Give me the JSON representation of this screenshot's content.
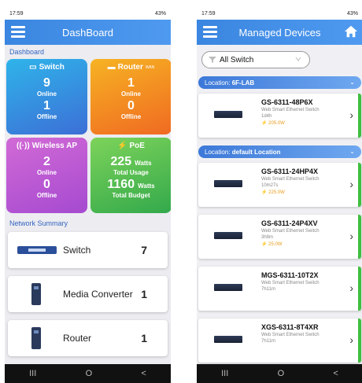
{
  "left": {
    "status": {
      "time": "17:59",
      "battery": "43%"
    },
    "appbar_title": "DashBoard",
    "section_label": "Dashboard",
    "tiles": {
      "switch": {
        "title": "Switch",
        "online": "9",
        "online_label": "Online",
        "offline": "1",
        "offline_label": "Offline"
      },
      "router": {
        "title": "Router",
        "title_suffix": "WAN",
        "online": "1",
        "online_label": "Online",
        "offline": "0",
        "offline_label": "Offline"
      },
      "wap": {
        "title": "Wireless AP",
        "online": "2",
        "online_label": "Online",
        "offline": "0",
        "offline_label": "Offline"
      },
      "poe": {
        "title": "PoE",
        "usage": "225",
        "usage_units": "Watts",
        "usage_label": "Total Usage",
        "budget": "1160",
        "budget_units": "Watts",
        "budget_label": "Total Budget"
      }
    },
    "summary_label": "Network Summary",
    "summary": [
      {
        "name": "Switch",
        "count": "7"
      },
      {
        "name": "Media Converter",
        "count": "1"
      },
      {
        "name": "Router",
        "count": "1"
      }
    ]
  },
  "right": {
    "status": {
      "time": "17:59",
      "battery": "43%"
    },
    "appbar_title": "Managed Devices",
    "filter_value": "All Switch",
    "location1": {
      "prefix": "Location: ",
      "name": "6F-LAB"
    },
    "location2": {
      "prefix": "Location: ",
      "name": "default Location"
    },
    "devices": [
      {
        "model": "GS-6311-48P6X",
        "desc": "Web Smart Ethernet Switch",
        "uptime": "1d4h",
        "power": "205.0W"
      },
      {
        "model": "GS-6311-24HP4X",
        "desc": "Web Smart Ethernet Switch",
        "uptime": "10m27s",
        "power": "225.0W"
      },
      {
        "model": "GS-6311-24P4XV",
        "desc": "Web Smart Ethernet Switch",
        "uptime": "3h9m",
        "power": "25.0W"
      },
      {
        "model": "MGS-6311-10T2X",
        "desc": "Web Smart Ethernet Switch",
        "uptime": "7h11m",
        "power": ""
      },
      {
        "model": "XGS-6311-8T4XR",
        "desc": "Web Smart Ethernet Switch",
        "uptime": "7h11m",
        "power": ""
      }
    ]
  },
  "nav": {
    "recent": "III",
    "home": "O",
    "back": "<"
  },
  "colors": {
    "accent": "#3a86e0",
    "switch_tile": "#2fb4ea",
    "router_tile": "#f6b323",
    "wap_tile": "#d26ad6",
    "poe_tile": "#7dd35a",
    "online_border": "#3fbf3f"
  }
}
